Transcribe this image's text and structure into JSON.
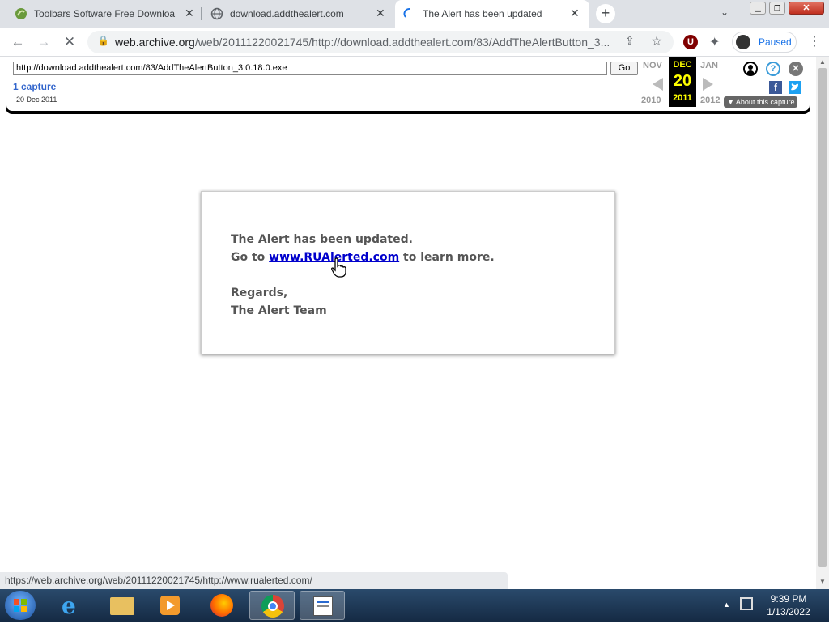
{
  "browser": {
    "tabs": [
      {
        "title": "Toolbars Software Free Downloa",
        "active": false,
        "icon": "leaf-icon"
      },
      {
        "title": "download.addthealert.com",
        "active": false,
        "icon": "globe-icon"
      },
      {
        "title": "The Alert has been updated",
        "active": true,
        "icon": "loading-spinner-icon"
      }
    ],
    "url_host": "web.archive.org",
    "url_path": "/web/20111220021745/http://download.addthealert.com/83/AddTheAlertButton_3...",
    "profile_label": "Paused"
  },
  "wayback": {
    "url_value": "http://download.addthealert.com/83/AddTheAlertButton_3.0.18.0.exe",
    "go_label": "Go",
    "captures_label": "1 capture",
    "capture_date": "20 Dec 2011",
    "prev_month": "NOV",
    "prev_year": "2010",
    "cur_month": "DEC",
    "cur_day": "20",
    "cur_year": "2011",
    "next_month": "JAN",
    "next_year": "2012",
    "about_label": "About this capture"
  },
  "page": {
    "line1": "The Alert has been updated.",
    "line2_prefix": "Go to ",
    "link_text": "www.RUAlerted.com",
    "line2_suffix": " to learn more.",
    "regards": "Regards,",
    "team": "The Alert Team"
  },
  "status_url": "https://web.archive.org/web/20111220021745/http://www.rualerted.com/",
  "taskbar": {
    "time": "9:39 PM",
    "date": "1/13/2022"
  }
}
